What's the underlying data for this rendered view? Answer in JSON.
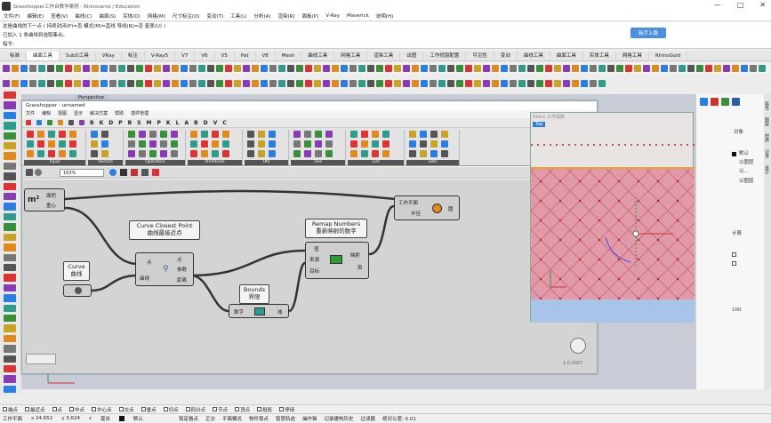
{
  "app": {
    "title": "Grasshopper工作台教学案例 - Rhinoceros / Education",
    "window_controls": [
      "—",
      "□",
      "✕"
    ]
  },
  "menubar": [
    "文件(F)",
    "编辑(E)",
    "查看(V)",
    "曲线(C)",
    "曲面(S)",
    "实体(O)",
    "网格(M)",
    "尺寸标注(D)",
    "变动(T)",
    "工具(L)",
    "分析(A)",
    "渲染(R)",
    "面板(P)",
    "V-Ray",
    "Maverick",
    "说明(H)"
  ],
  "command": {
    "line1": "这是曲线的下一点 ( 持续封闭(P)=否  模式(M)=直线  导线(N)=否  复原(U) )",
    "line2": "已加入 1 条曲线到选取集合。",
    "line3": "指令:",
    "help_button": "新手上路"
  },
  "toolbar_tabs": [
    "标准",
    "曲面工具",
    "SubD工具",
    "VRay",
    "标注",
    "V-Ray5",
    "V7",
    "V6",
    "V5",
    "Pat",
    "V8",
    "Mesh",
    "曲线工具",
    "网格工具",
    "渲染工具",
    "出图",
    "工作视窗配置",
    "可见性",
    "变动",
    "曲线工具",
    "曲面工具",
    "实体工具",
    "网格工具",
    "RhinoGold"
  ],
  "rhino_viewport": {
    "label": "Perspective"
  },
  "grasshopper": {
    "title": "Grasshopper - unnamed",
    "menu": [
      "文件",
      "编辑",
      "视图",
      "显示",
      "解决方案",
      "帮助",
      "插件管理"
    ],
    "tab_letters": [
      "B",
      "K",
      "D",
      "P",
      "B",
      "S",
      "M",
      "P",
      "K",
      "L",
      "A",
      "B",
      "D",
      "V",
      "C"
    ],
    "ribbon_groups": [
      "Input",
      "Vectors",
      "Operators",
      "Primitives",
      "Util",
      "Tree",
      "List",
      "Sets"
    ],
    "zoom": "163%",
    "version": "1.0.0007"
  },
  "components": {
    "plane": {
      "out1": "面积",
      "out2": "重心"
    },
    "curve_closest": {
      "callout1": "Curve Closest Point",
      "callout2": "曲线最接近点",
      "in1": "点",
      "in2": "曲线",
      "out1": "点",
      "out2": "参数",
      "out3": "距离"
    },
    "curve_param": {
      "callout1": "Curve",
      "callout2": "曲线"
    },
    "bounds": {
      "callout1": "Bounds",
      "callout2": "界限",
      "in": "数字",
      "out": "域"
    },
    "remap": {
      "callout1": "Remap Numbers",
      "callout2": "重新映射的数字",
      "in1": "值",
      "in2": "来源",
      "in3": "目标",
      "out1": "映射",
      "out2": "剪"
    },
    "workplane": {
      "in1": "工作平面",
      "in2": "半径",
      "out": "圆"
    }
  },
  "viewport_window": {
    "title": "Rhino 工作视窗",
    "tag": "Top"
  },
  "right_panel": {
    "labels": [
      "默认",
      "以图层",
      "以...",
      "以图层"
    ],
    "section": "对象",
    "field": "计算",
    "unit": "100"
  },
  "right_strip": [
    "属性",
    "图层",
    "材质",
    "记事",
    "显示"
  ],
  "statusbar1": [
    "端点",
    "最近点",
    "点",
    "中点",
    "中心点",
    "交点",
    "垂点",
    "切点",
    "四分点",
    "节点",
    "顶点",
    "投影",
    "停用"
  ],
  "statusbar2": {
    "plane": "工作平面",
    "x": "x 24.652",
    "y": "y 3.624",
    "z": "z",
    "unit": "毫米",
    "layer": "默认",
    "items": [
      "锁定格点",
      "正交",
      "平面模式",
      "物件锁点",
      "智慧轨迹",
      "操作轴",
      "记录建构历史",
      "过滤器",
      "绝对公差: 0.01"
    ]
  },
  "colors": {
    "accent": "#2a7de1",
    "gh_canvas": "#d4d4d4",
    "pattern": "#e18fa0",
    "grid_red": "#d23030"
  }
}
